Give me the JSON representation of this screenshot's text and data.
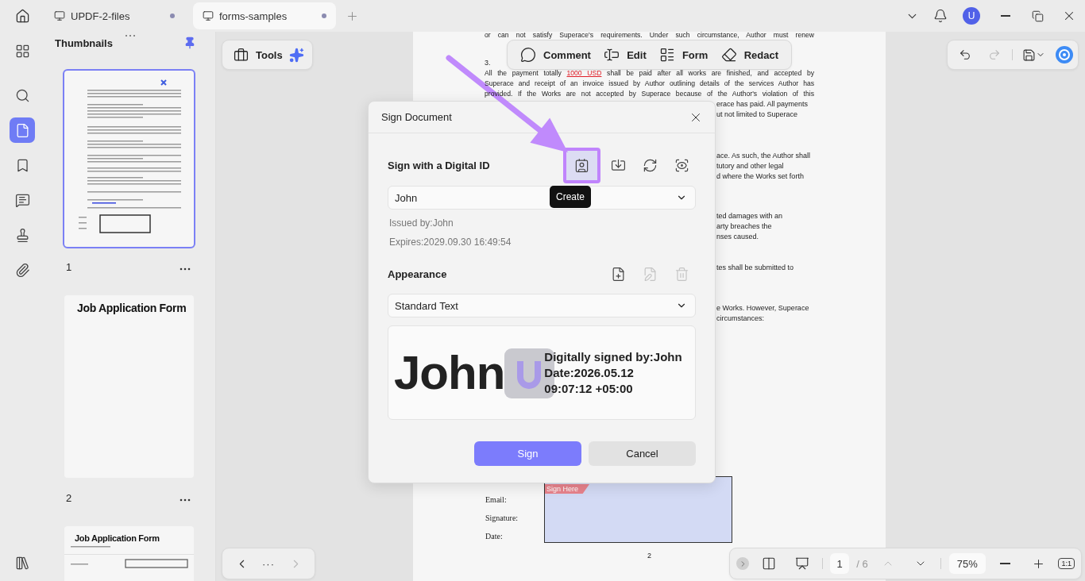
{
  "tabs": [
    {
      "label": "UPDF-2-files",
      "selected": false
    },
    {
      "label": "forms-samples",
      "selected": true
    }
  ],
  "user": {
    "initial": "U"
  },
  "sidebar": {
    "items": [
      {
        "kind": "apps",
        "selected": false
      },
      {
        "kind": "search",
        "selected": false
      },
      {
        "kind": "pages",
        "selected": true
      },
      {
        "kind": "bookmark",
        "selected": false
      },
      {
        "kind": "comments",
        "selected": false
      },
      {
        "kind": "stamp",
        "selected": false
      },
      {
        "kind": "attachment",
        "selected": false
      }
    ],
    "bottom": {
      "kind": "library"
    }
  },
  "thumbnails": {
    "title": "Thumbnails",
    "pages": [
      {
        "kind": "contract",
        "number": "1",
        "selected": true
      },
      {
        "kind": "form",
        "number": "2",
        "title": "Job Application Form",
        "selected": false
      },
      {
        "kind": "form_fields",
        "title": "Job Application Form",
        "selected": false
      }
    ]
  },
  "tools": {
    "label": "Tools"
  },
  "edit_toolbar": [
    {
      "kind": "comment",
      "label": "Comment"
    },
    {
      "kind": "edit",
      "label": "Edit"
    },
    {
      "kind": "form",
      "label": "Form"
    },
    {
      "kind": "redact",
      "label": "Redact"
    }
  ],
  "history": {
    "undo_disabled": false,
    "redo_disabled": true
  },
  "document": {
    "blocks": [
      [
        {
          "kind": "full",
          "text": "or can not satisfy Superace's requirements. Under such circumstance, Author must renew"
        }
      ],
      [
        {
          "kind": "plain",
          "text": "3."
        },
        {
          "kind": "full",
          "text": "All the payment totally ",
          "highlight": "1000 USD",
          "rest": " shall be paid after all works are finished, and accepted by"
        },
        {
          "kind": "full",
          "text": "Superace and receipt of an invoice issued by Author outlining details of the services Author has"
        },
        {
          "kind": "full",
          "text": "provided. If the Works are not accepted by Superace because of the Author's violation of this"
        },
        {
          "kind": "tail",
          "text": "erace has paid. All payments"
        },
        {
          "kind": "tail",
          "text": "ut not limited to Superace"
        }
      ],
      [
        {
          "kind": "tail",
          "text": "ace. As such, the Author shall"
        },
        {
          "kind": "tail",
          "text": "tutory and other legal"
        },
        {
          "kind": "tail",
          "text": "d where the Works set forth"
        }
      ],
      [
        {
          "kind": "tail",
          "text": "ted damages with an"
        },
        {
          "kind": "tail",
          "text": "arty breaches the"
        },
        {
          "kind": "tail",
          "text": "nses caused."
        }
      ],
      [
        {
          "kind": "tail",
          "text": "tes shall be submitted to"
        }
      ],
      [
        {
          "kind": "tail",
          "text": "e Works. However, Superace"
        },
        {
          "kind": "tail",
          "text": "circumstances:"
        }
      ]
    ],
    "sign_here": "Sign Here",
    "form_labels": [
      "Email:",
      "Signature:",
      "Date:"
    ],
    "page_number": "2"
  },
  "dialog": {
    "title": "Sign Document",
    "digital_id": {
      "label": "Sign with a Digital ID",
      "actions": [
        {
          "kind": "create",
          "selected": true
        },
        {
          "kind": "import",
          "selected": false
        },
        {
          "kind": "refresh",
          "selected": false
        },
        {
          "kind": "view",
          "selected": false
        }
      ],
      "tooltip": "Create",
      "value": "John",
      "issued_by": "Issued by:John",
      "expires": "Expires:2029.09.30 16:49:54"
    },
    "appearance": {
      "label": "Appearance",
      "actions": [
        {
          "kind": "add",
          "disabled": false
        },
        {
          "kind": "edit",
          "disabled": true
        },
        {
          "kind": "delete",
          "disabled": true
        }
      ],
      "value": "Standard Text",
      "preview": {
        "name": "John",
        "lines": [
          "Digitally signed by:John",
          "Date:2026.05.12",
          "09:07:12 +05:00"
        ]
      }
    },
    "buttons": [
      {
        "kind": "primary",
        "label": "Sign"
      },
      {
        "kind": "secondary",
        "label": "Cancel"
      }
    ]
  },
  "navigation": {
    "more": "···",
    "next_disabled": true
  },
  "pager": {
    "page": "1",
    "total": "/ 6",
    "up_disabled": true,
    "zoom": "75%",
    "actual_size": "1:1"
  }
}
